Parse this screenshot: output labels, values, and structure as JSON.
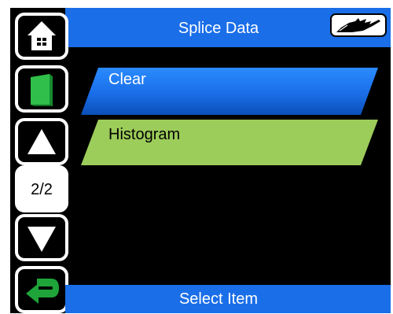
{
  "header": {
    "title": "Splice Data"
  },
  "menu": {
    "items": [
      {
        "label": "Clear",
        "color": "#1a6ee8",
        "text_color": "#ffffff"
      },
      {
        "label": "Histogram",
        "color": "#9ccc5a",
        "text_color": "#000000"
      }
    ]
  },
  "sidebar": {
    "page_indicator": "2/2"
  },
  "status": {
    "hint": "Select Item"
  },
  "colors": {
    "accent_blue": "#1a6ee8",
    "book_green": "#2fbf4a",
    "back_green": "#1fa43a"
  },
  "icons": [
    "home-icon",
    "book-icon",
    "up-arrow-icon",
    "down-arrow-icon",
    "back-arrow-icon",
    "cable-icon"
  ]
}
